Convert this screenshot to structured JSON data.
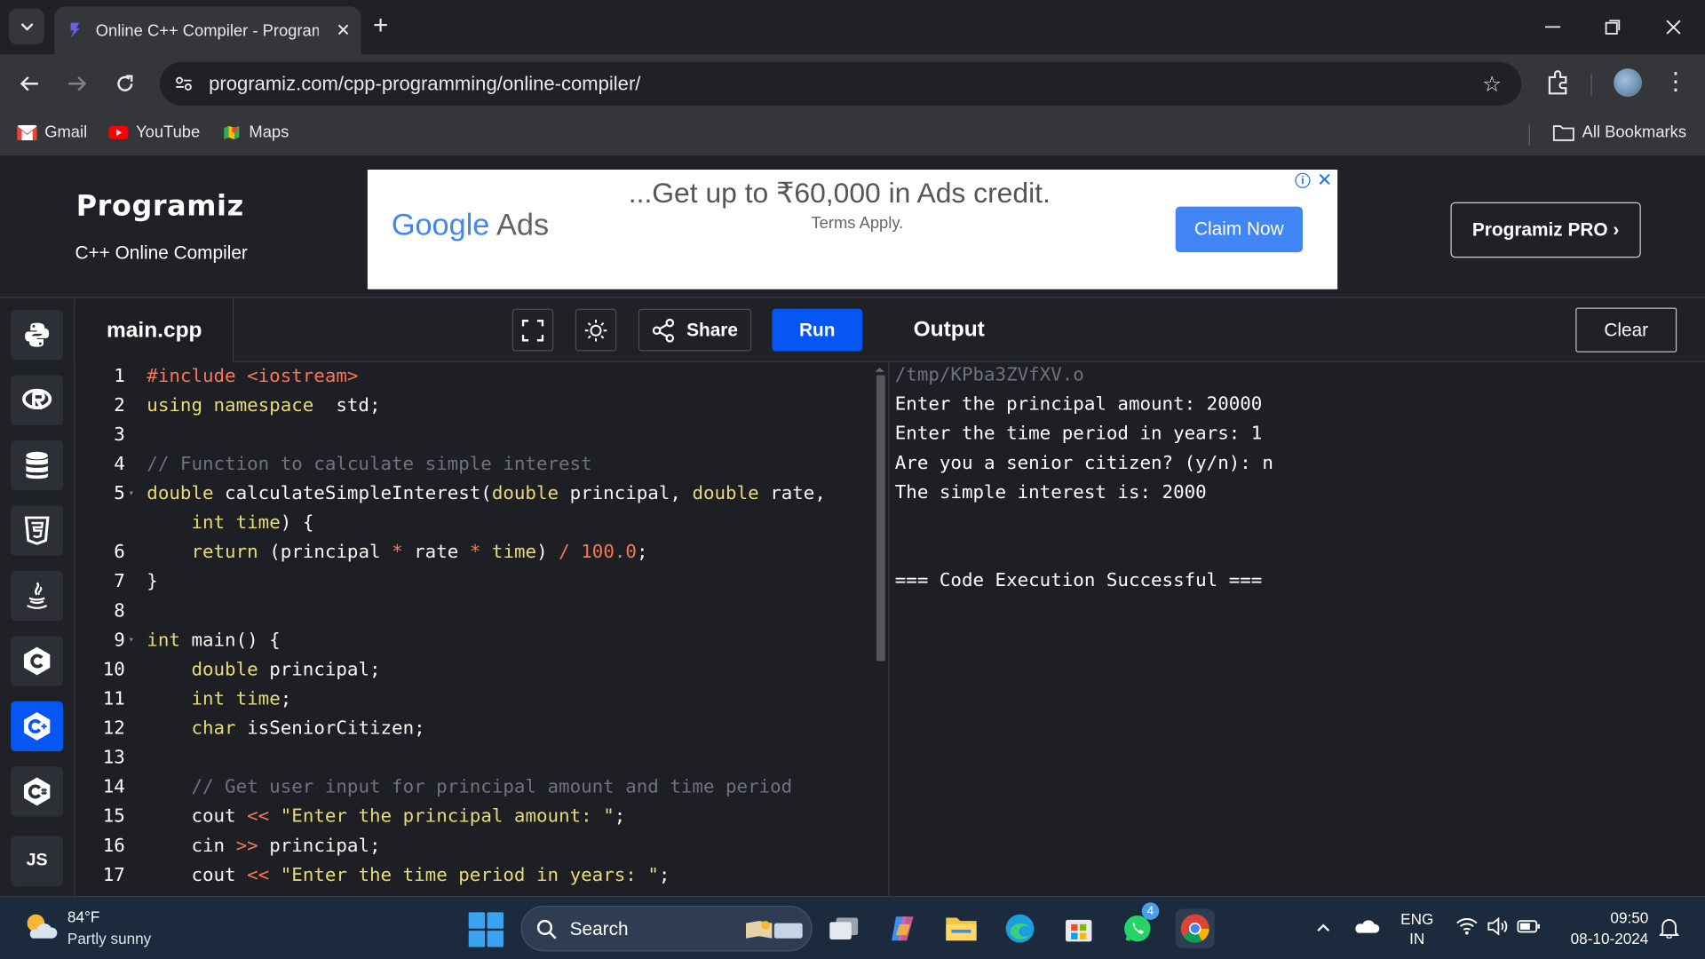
{
  "browser": {
    "tab_title": "Online C++ Compiler - Programiz",
    "url": "programiz.com/cpp-programming/online-compiler/",
    "bookmarks": [
      {
        "label": "Gmail",
        "icon": "gmail-icon"
      },
      {
        "label": "YouTube",
        "icon": "youtube-icon"
      },
      {
        "label": "Maps",
        "icon": "maps-icon"
      }
    ],
    "all_bookmarks": "All Bookmarks"
  },
  "header": {
    "logo": "Programiz",
    "subtitle": "C++ Online Compiler",
    "pro_button": "Programiz PRO ›"
  },
  "ad": {
    "brand_google": "Google",
    "brand_ads": "Ads",
    "headline": "...Get up to ₹60,000 in Ads credit.",
    "subtext": "Terms Apply.",
    "cta": "Claim Now"
  },
  "languages": [
    {
      "name": "python",
      "icon": "python-icon"
    },
    {
      "name": "r",
      "icon": "r-icon"
    },
    {
      "name": "sql",
      "icon": "database-icon"
    },
    {
      "name": "html",
      "icon": "html5-icon"
    },
    {
      "name": "java",
      "icon": "java-icon"
    },
    {
      "name": "c",
      "icon": "c-icon"
    },
    {
      "name": "cpp",
      "icon": "cpp-icon",
      "active": true
    },
    {
      "name": "csharp",
      "icon": "csharp-icon"
    },
    {
      "name": "js",
      "label": "JS",
      "icon": "js-icon"
    }
  ],
  "editor": {
    "filename": "main.cpp",
    "share_label": "Share",
    "run_label": "Run",
    "lines": [
      {
        "n": "1",
        "tokens": [
          [
            "inc",
            "#include "
          ],
          [
            "inc",
            "<iostream>"
          ]
        ]
      },
      {
        "n": "2",
        "tokens": [
          [
            "kw",
            "using namespace"
          ],
          [
            "",
            "  std;"
          ]
        ]
      },
      {
        "n": "3",
        "tokens": []
      },
      {
        "n": "4",
        "tokens": [
          [
            "cm",
            "// Function to calculate simple interest"
          ]
        ]
      },
      {
        "n": "5",
        "fold": true,
        "tokens": [
          [
            "kw",
            "double"
          ],
          [
            "",
            " calculateSimpleInterest("
          ],
          [
            "kw",
            "double"
          ],
          [
            "",
            " principal, "
          ],
          [
            "kw",
            "double"
          ],
          [
            "",
            " rate,"
          ]
        ]
      },
      {
        "n": "",
        "tokens": [
          [
            "",
            "    "
          ],
          [
            "kw",
            "int"
          ],
          [
            "",
            " "
          ],
          [
            "kw",
            "time"
          ],
          [
            "",
            ") {"
          ]
        ]
      },
      {
        "n": "6",
        "tokens": [
          [
            "",
            "    "
          ],
          [
            "kw",
            "return"
          ],
          [
            "",
            " (principal "
          ],
          [
            "op",
            "*"
          ],
          [
            "",
            " rate "
          ],
          [
            "op",
            "*"
          ],
          [
            "",
            " "
          ],
          [
            "kw",
            "time"
          ],
          [
            "",
            ") "
          ],
          [
            "op",
            "/"
          ],
          [
            "",
            " "
          ],
          [
            "num",
            "100.0"
          ],
          [
            "",
            ";"
          ]
        ]
      },
      {
        "n": "7",
        "tokens": [
          [
            "",
            "}"
          ]
        ]
      },
      {
        "n": "8",
        "tokens": []
      },
      {
        "n": "9",
        "fold": true,
        "tokens": [
          [
            "kw",
            "int"
          ],
          [
            "",
            " main() {"
          ]
        ]
      },
      {
        "n": "10",
        "tokens": [
          [
            "",
            "    "
          ],
          [
            "kw",
            "double"
          ],
          [
            "",
            " principal;"
          ]
        ]
      },
      {
        "n": "11",
        "tokens": [
          [
            "",
            "    "
          ],
          [
            "kw",
            "int"
          ],
          [
            "",
            " "
          ],
          [
            "kw",
            "time"
          ],
          [
            "",
            ";"
          ]
        ]
      },
      {
        "n": "12",
        "tokens": [
          [
            "",
            "    "
          ],
          [
            "kw",
            "char"
          ],
          [
            "",
            " isSeniorCitizen;"
          ]
        ]
      },
      {
        "n": "13",
        "tokens": []
      },
      {
        "n": "14",
        "tokens": [
          [
            "",
            "    "
          ],
          [
            "cm",
            "// Get user input for principal amount and time period"
          ]
        ]
      },
      {
        "n": "15",
        "tokens": [
          [
            "",
            "    cout "
          ],
          [
            "op",
            "<<"
          ],
          [
            "",
            " "
          ],
          [
            "str",
            "\"Enter the principal amount: \""
          ],
          [
            "",
            ";"
          ]
        ]
      },
      {
        "n": "16",
        "tokens": [
          [
            "",
            "    cin "
          ],
          [
            "op",
            ">>"
          ],
          [
            "",
            " principal;"
          ]
        ]
      },
      {
        "n": "17",
        "tokens": [
          [
            "",
            "    cout "
          ],
          [
            "op",
            "<<"
          ],
          [
            "",
            " "
          ],
          [
            "str",
            "\"Enter the time period in years: \""
          ],
          [
            "",
            ";"
          ]
        ]
      }
    ]
  },
  "output": {
    "title": "Output",
    "clear_label": "Clear",
    "path": "/tmp/KPba3ZVfXV.o",
    "lines": [
      "Enter the principal amount: 20000",
      "Enter the time period in years: 1",
      "Are you a senior citizen? (y/n): n",
      "The simple interest is: 2000",
      "",
      "",
      "=== Code Execution Successful ==="
    ]
  },
  "taskbar": {
    "temp": "84°F",
    "condition": "Partly sunny",
    "search": "Search",
    "whatsapp_badge": "4",
    "lang_top": "ENG",
    "lang_bottom": "IN",
    "time": "09:50",
    "date": "08-10-2024"
  },
  "colors": {
    "run_button": "#0556f3",
    "keyword": "#e6db74",
    "comment": "#6e7381",
    "number": "#f97555",
    "ad_cta": "#4285f4"
  }
}
